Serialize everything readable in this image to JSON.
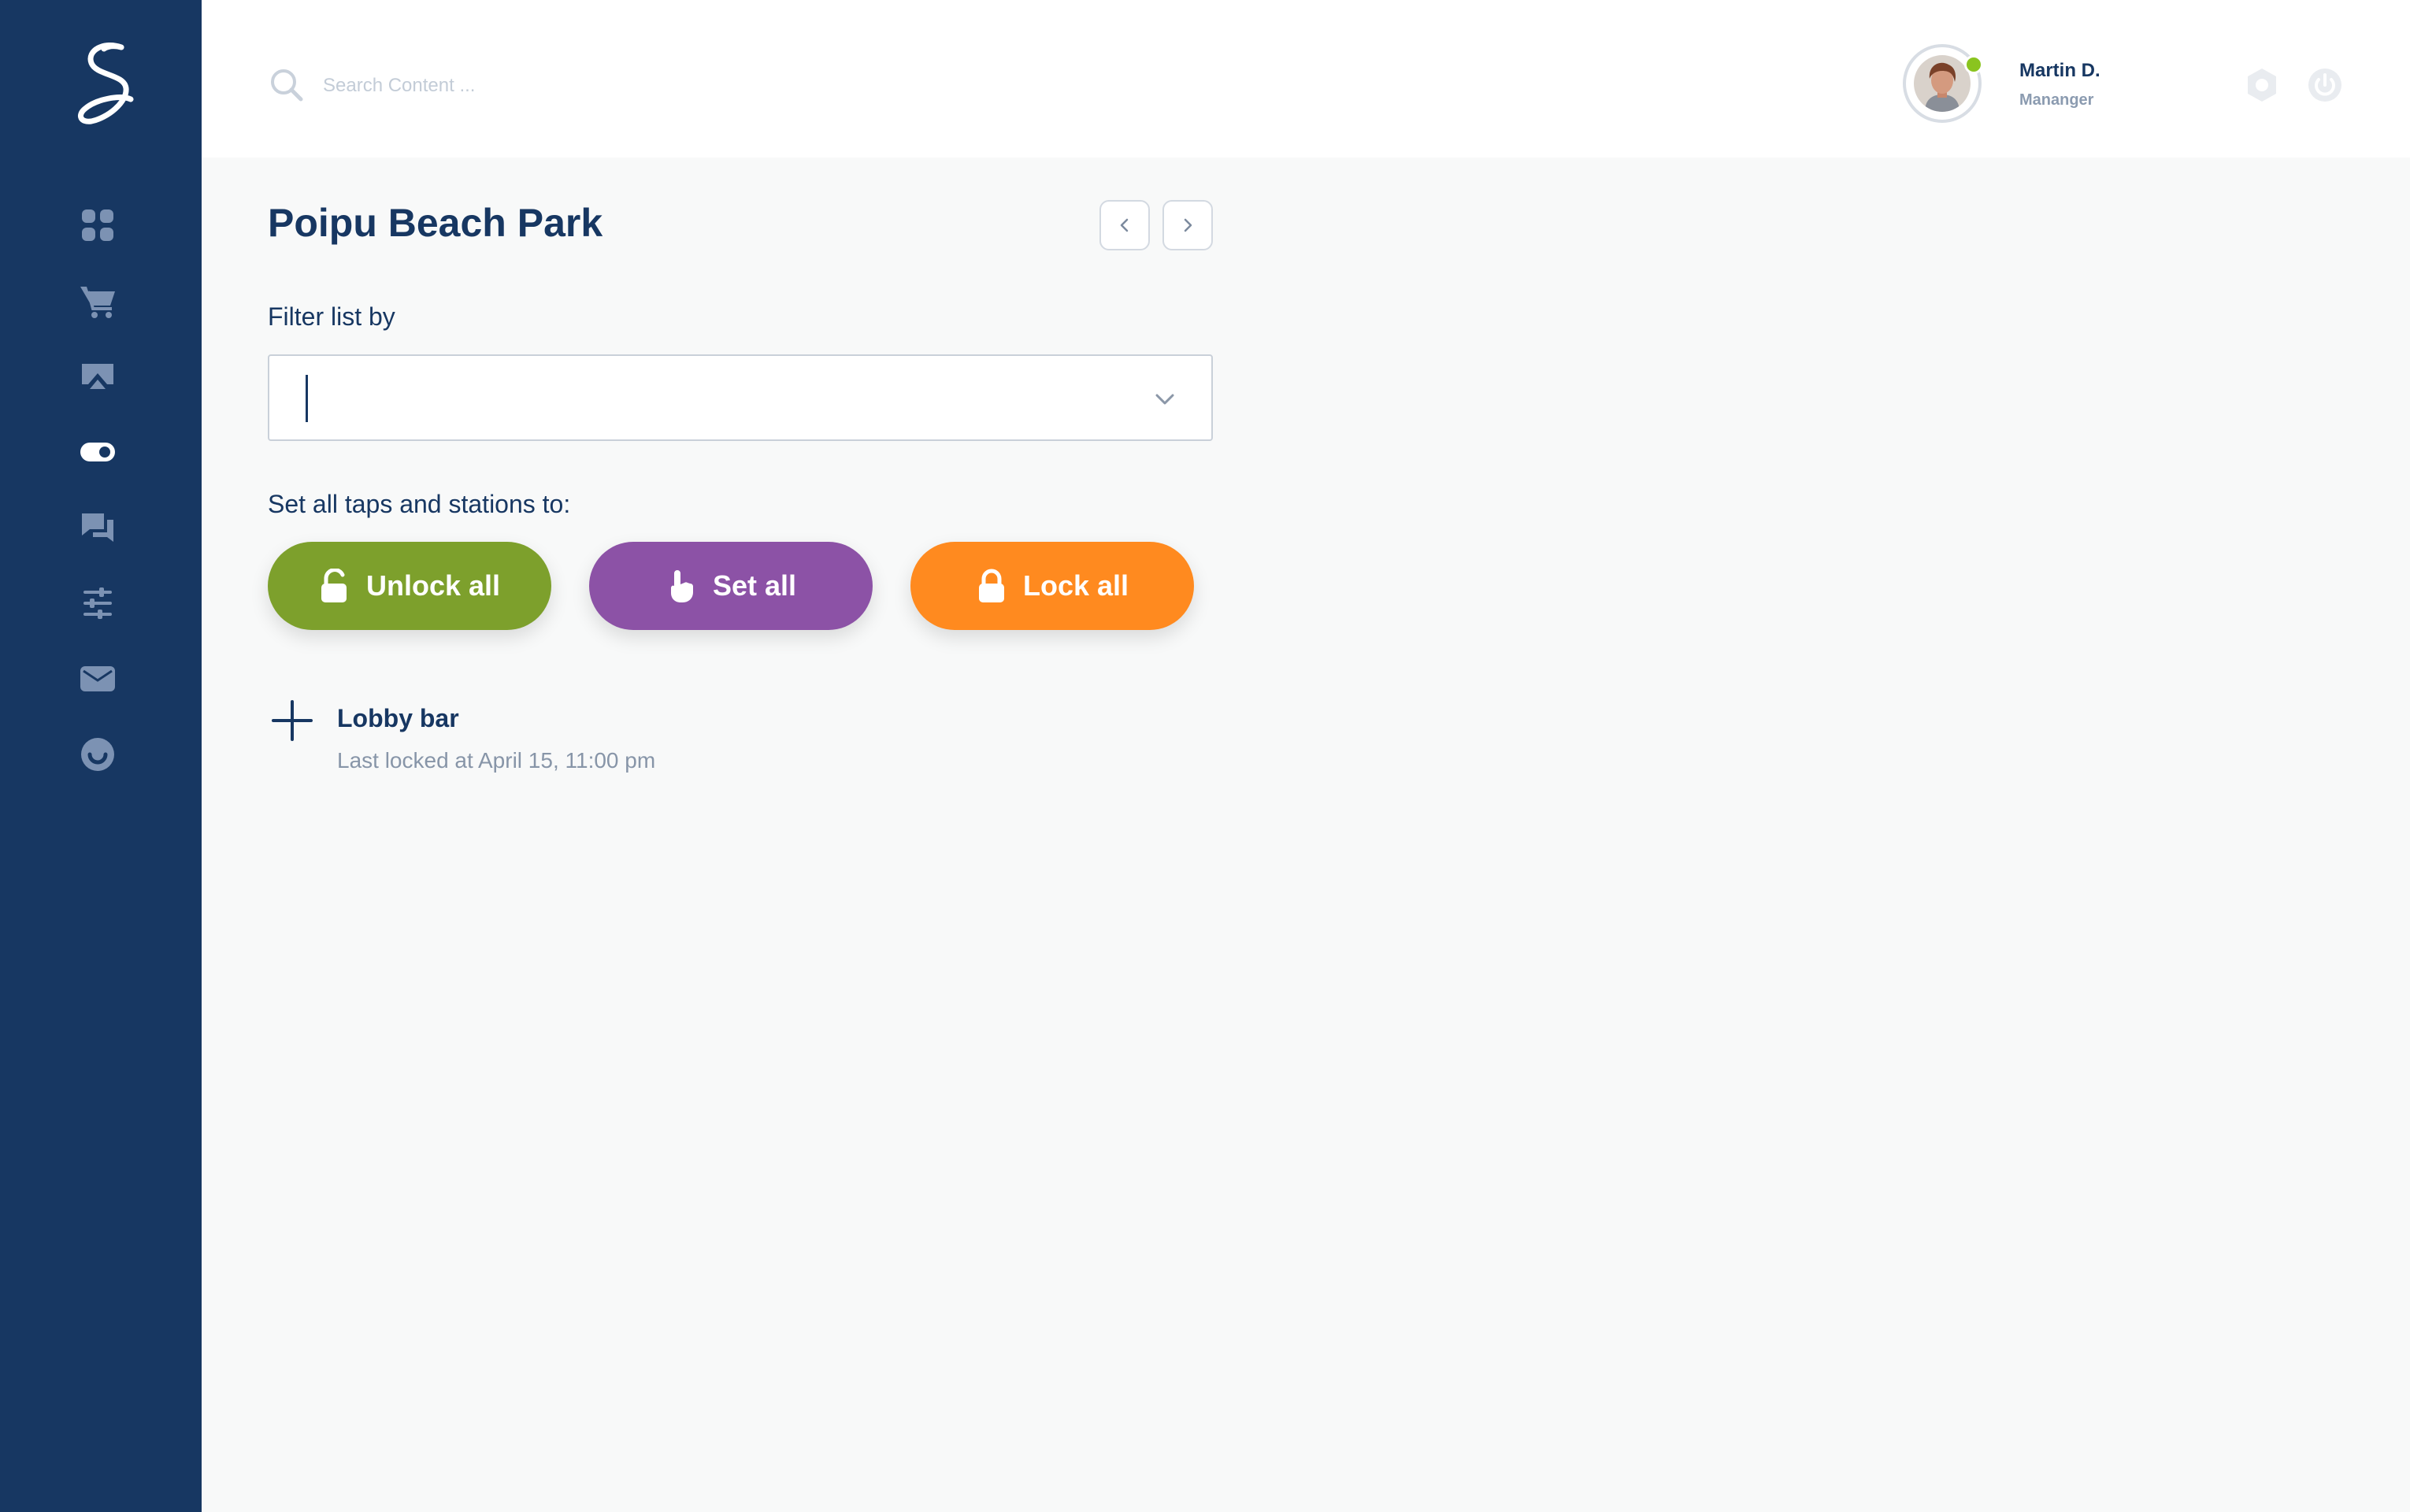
{
  "app": {
    "colors": {
      "sidebar": "#173762",
      "nav_icon": "#7c92b3",
      "nav_icon_active": "#ffffff",
      "unlock": "#7da02c",
      "set": "#8c52a6",
      "lock": "#ff8a1f",
      "status_online": "#8ac41f"
    }
  },
  "sidebar": {
    "logo_icon": "script-s-logo",
    "items": [
      {
        "icon": "dashboard-grid-icon",
        "active": false
      },
      {
        "icon": "cart-icon",
        "active": false
      },
      {
        "icon": "screen-cast-icon",
        "active": false
      },
      {
        "icon": "toggle-icon",
        "active": true
      },
      {
        "icon": "chat-icon",
        "active": false
      },
      {
        "icon": "sliders-icon",
        "active": false
      },
      {
        "icon": "mail-icon",
        "active": false
      },
      {
        "icon": "smiley-icon",
        "active": false
      }
    ]
  },
  "header": {
    "search": {
      "placeholder": "Search Content ...",
      "value": ""
    },
    "user": {
      "name": "Martin D.",
      "role": "Mananger",
      "online": true
    },
    "icons": [
      "settings-icon",
      "power-icon"
    ]
  },
  "main": {
    "title": "Poipu Beach Park",
    "filter": {
      "label": "Filter list by",
      "value": ""
    },
    "set_all_label": "Set all taps and stations to:",
    "buttons": {
      "unlock": "Unlock all",
      "set": "Set all",
      "lock": "Lock all"
    },
    "locations": [
      {
        "name": "Lobby bar",
        "status": "Last locked at April 15, 11:00 pm"
      }
    ]
  }
}
